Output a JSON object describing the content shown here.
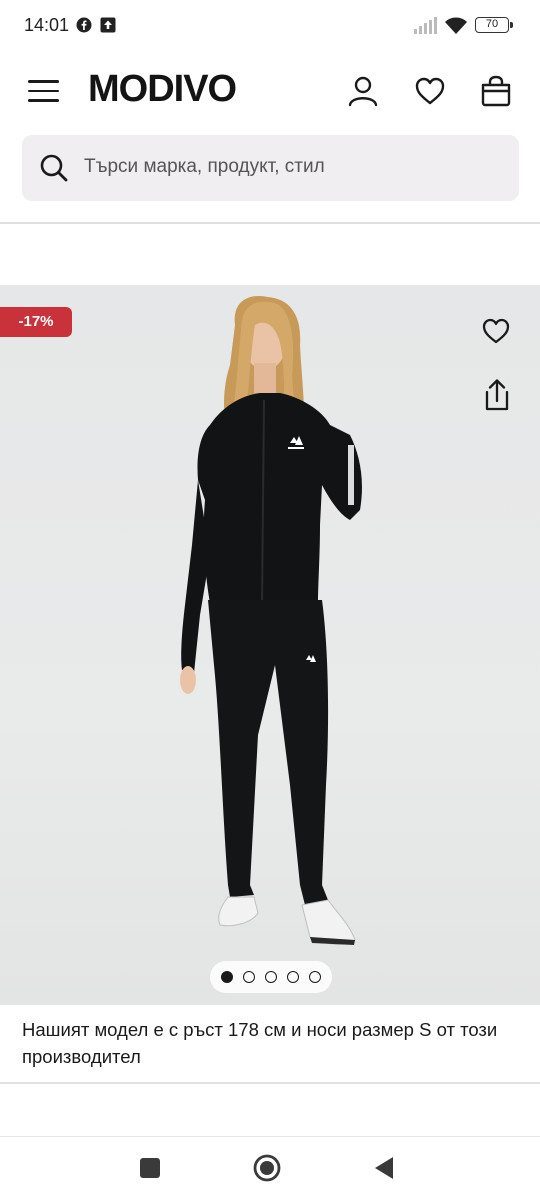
{
  "status_bar": {
    "time": "14:01",
    "battery": "70",
    "icons": [
      "facebook-icon",
      "upload-icon",
      "signal-icon",
      "wifi-icon",
      "battery-icon"
    ]
  },
  "header": {
    "logo": "MODIVO",
    "icons": [
      "menu-icon",
      "user-icon",
      "heart-icon",
      "bag-icon"
    ]
  },
  "search": {
    "placeholder": "Търси марка, продукт, стил",
    "icon": "search-icon"
  },
  "product": {
    "discount": "-17%",
    "caption": "Нашият модел е с ръст 178 см и носи размер S от този производител",
    "gallery_count": 5,
    "active_index": 0,
    "colors": {
      "badge": "#c9323a",
      "image_bg": "#e7e8e8"
    }
  },
  "nav_bar": {
    "icons": [
      "recents-icon",
      "home-icon",
      "back-icon"
    ]
  }
}
